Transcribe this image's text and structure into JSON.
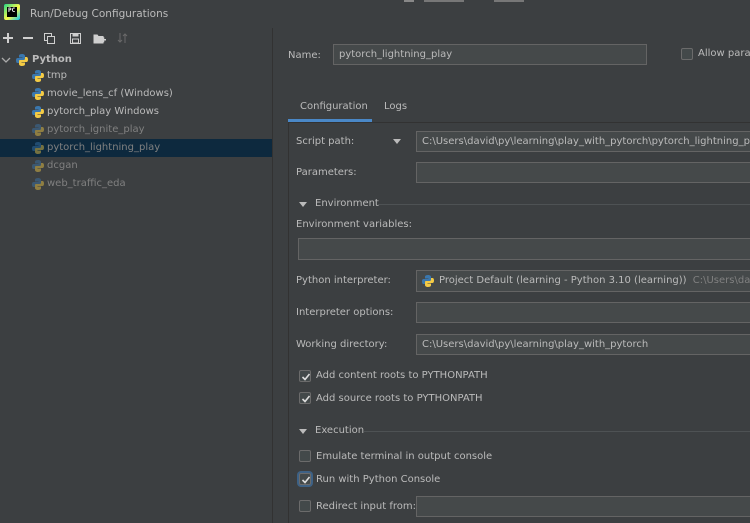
{
  "window": {
    "title": "Run/Debug Configurations"
  },
  "toolbar": {
    "icons": [
      "plus-icon",
      "minus-icon",
      "copy-icon",
      "save-icon",
      "folder-add-icon",
      "sort-icon"
    ]
  },
  "tree": {
    "root": {
      "label": "Python",
      "expanded": true
    },
    "items": [
      {
        "label": "tmp",
        "selected": false,
        "dimmed": false
      },
      {
        "label": "movie_lens_cf (Windows)",
        "selected": false,
        "dimmed": false
      },
      {
        "label": "pytorch_play Windows",
        "selected": false,
        "dimmed": false
      },
      {
        "label": "pytorch_ignite_play",
        "selected": false,
        "dimmed": true
      },
      {
        "label": "pytorch_lightning_play",
        "selected": true,
        "dimmed": true
      },
      {
        "label": "dcgan",
        "selected": false,
        "dimmed": true
      },
      {
        "label": "web_traffic_eda",
        "selected": false,
        "dimmed": true
      }
    ]
  },
  "header": {
    "name_label": "Name:",
    "name_value": "pytorch_lightning_play",
    "allow_parallel_label": "Allow paralle",
    "allow_parallel_checked": false
  },
  "tabs": [
    {
      "label": "Configuration",
      "active": true
    },
    {
      "label": "Logs",
      "active": false
    }
  ],
  "config": {
    "script_path_label": "Script path:",
    "script_path_value": "C:\\Users\\david\\py\\learning\\play_with_pytorch\\pytorch_lightning_play.py",
    "parameters_label": "Parameters:",
    "parameters_value": "",
    "environment_section": "Environment",
    "env_vars_label": "Environment variables:",
    "env_vars_value": "",
    "interpreter_label": "Python interpreter:",
    "interpreter_value": "Project Default (learning - Python 3.10 (learning))",
    "interpreter_path": "C:\\Users\\david\\py\\le",
    "interpreter_options_label": "Interpreter options:",
    "interpreter_options_value": "",
    "working_dir_label": "Working directory:",
    "working_dir_value": "C:\\Users\\david\\py\\learning\\play_with_pytorch",
    "add_content_roots_label": "Add content roots to PYTHONPATH",
    "add_content_roots_checked": true,
    "add_source_roots_label": "Add source roots to PYTHONPATH",
    "add_source_roots_checked": true,
    "execution_section": "Execution",
    "emulate_terminal_label": "Emulate terminal in output console",
    "emulate_terminal_checked": false,
    "run_with_console_label": "Run with Python Console",
    "run_with_console_checked": true,
    "redirect_input_label": "Redirect input from:",
    "redirect_input_checked": false,
    "redirect_input_value": ""
  },
  "colors": {
    "background": "#3c3f41",
    "field_bg": "#45494a",
    "selection": "#0d293e",
    "accent": "#4a88c7",
    "text": "#bbbbbb"
  }
}
